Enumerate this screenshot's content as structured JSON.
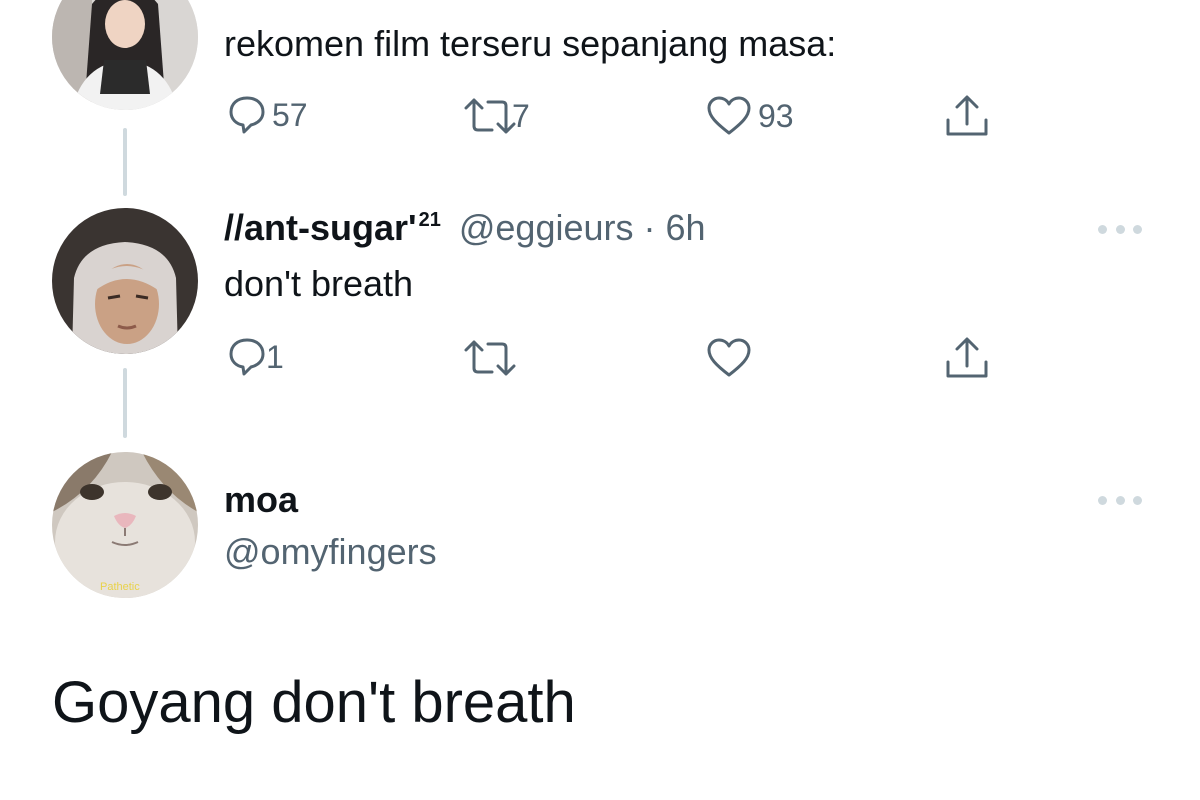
{
  "tweets": [
    {
      "text": "rekomen film terseru sepanjang masa:",
      "replies": "57",
      "retweets": "7",
      "likes": "93"
    },
    {
      "display_name": "//ant-sugar'",
      "name_superscript": "21",
      "handle_time": "@eggieurs · 6h",
      "text": "don't breath",
      "replies": "1",
      "retweets": "",
      "likes": ""
    },
    {
      "display_name": "moa",
      "handle": "@omyfingers",
      "avatar_caption": "Pathetic"
    }
  ],
  "caption": "Goyang don't breath",
  "icons": {
    "reply": "speech-bubble-icon",
    "retweet": "retweet-arrows-icon",
    "like": "heart-outline-icon",
    "share": "share-upload-icon",
    "more": "ellipsis-icon"
  },
  "colors": {
    "text": "#0f1419",
    "secondary": "#536471",
    "thread_line": "#cfd9de"
  }
}
